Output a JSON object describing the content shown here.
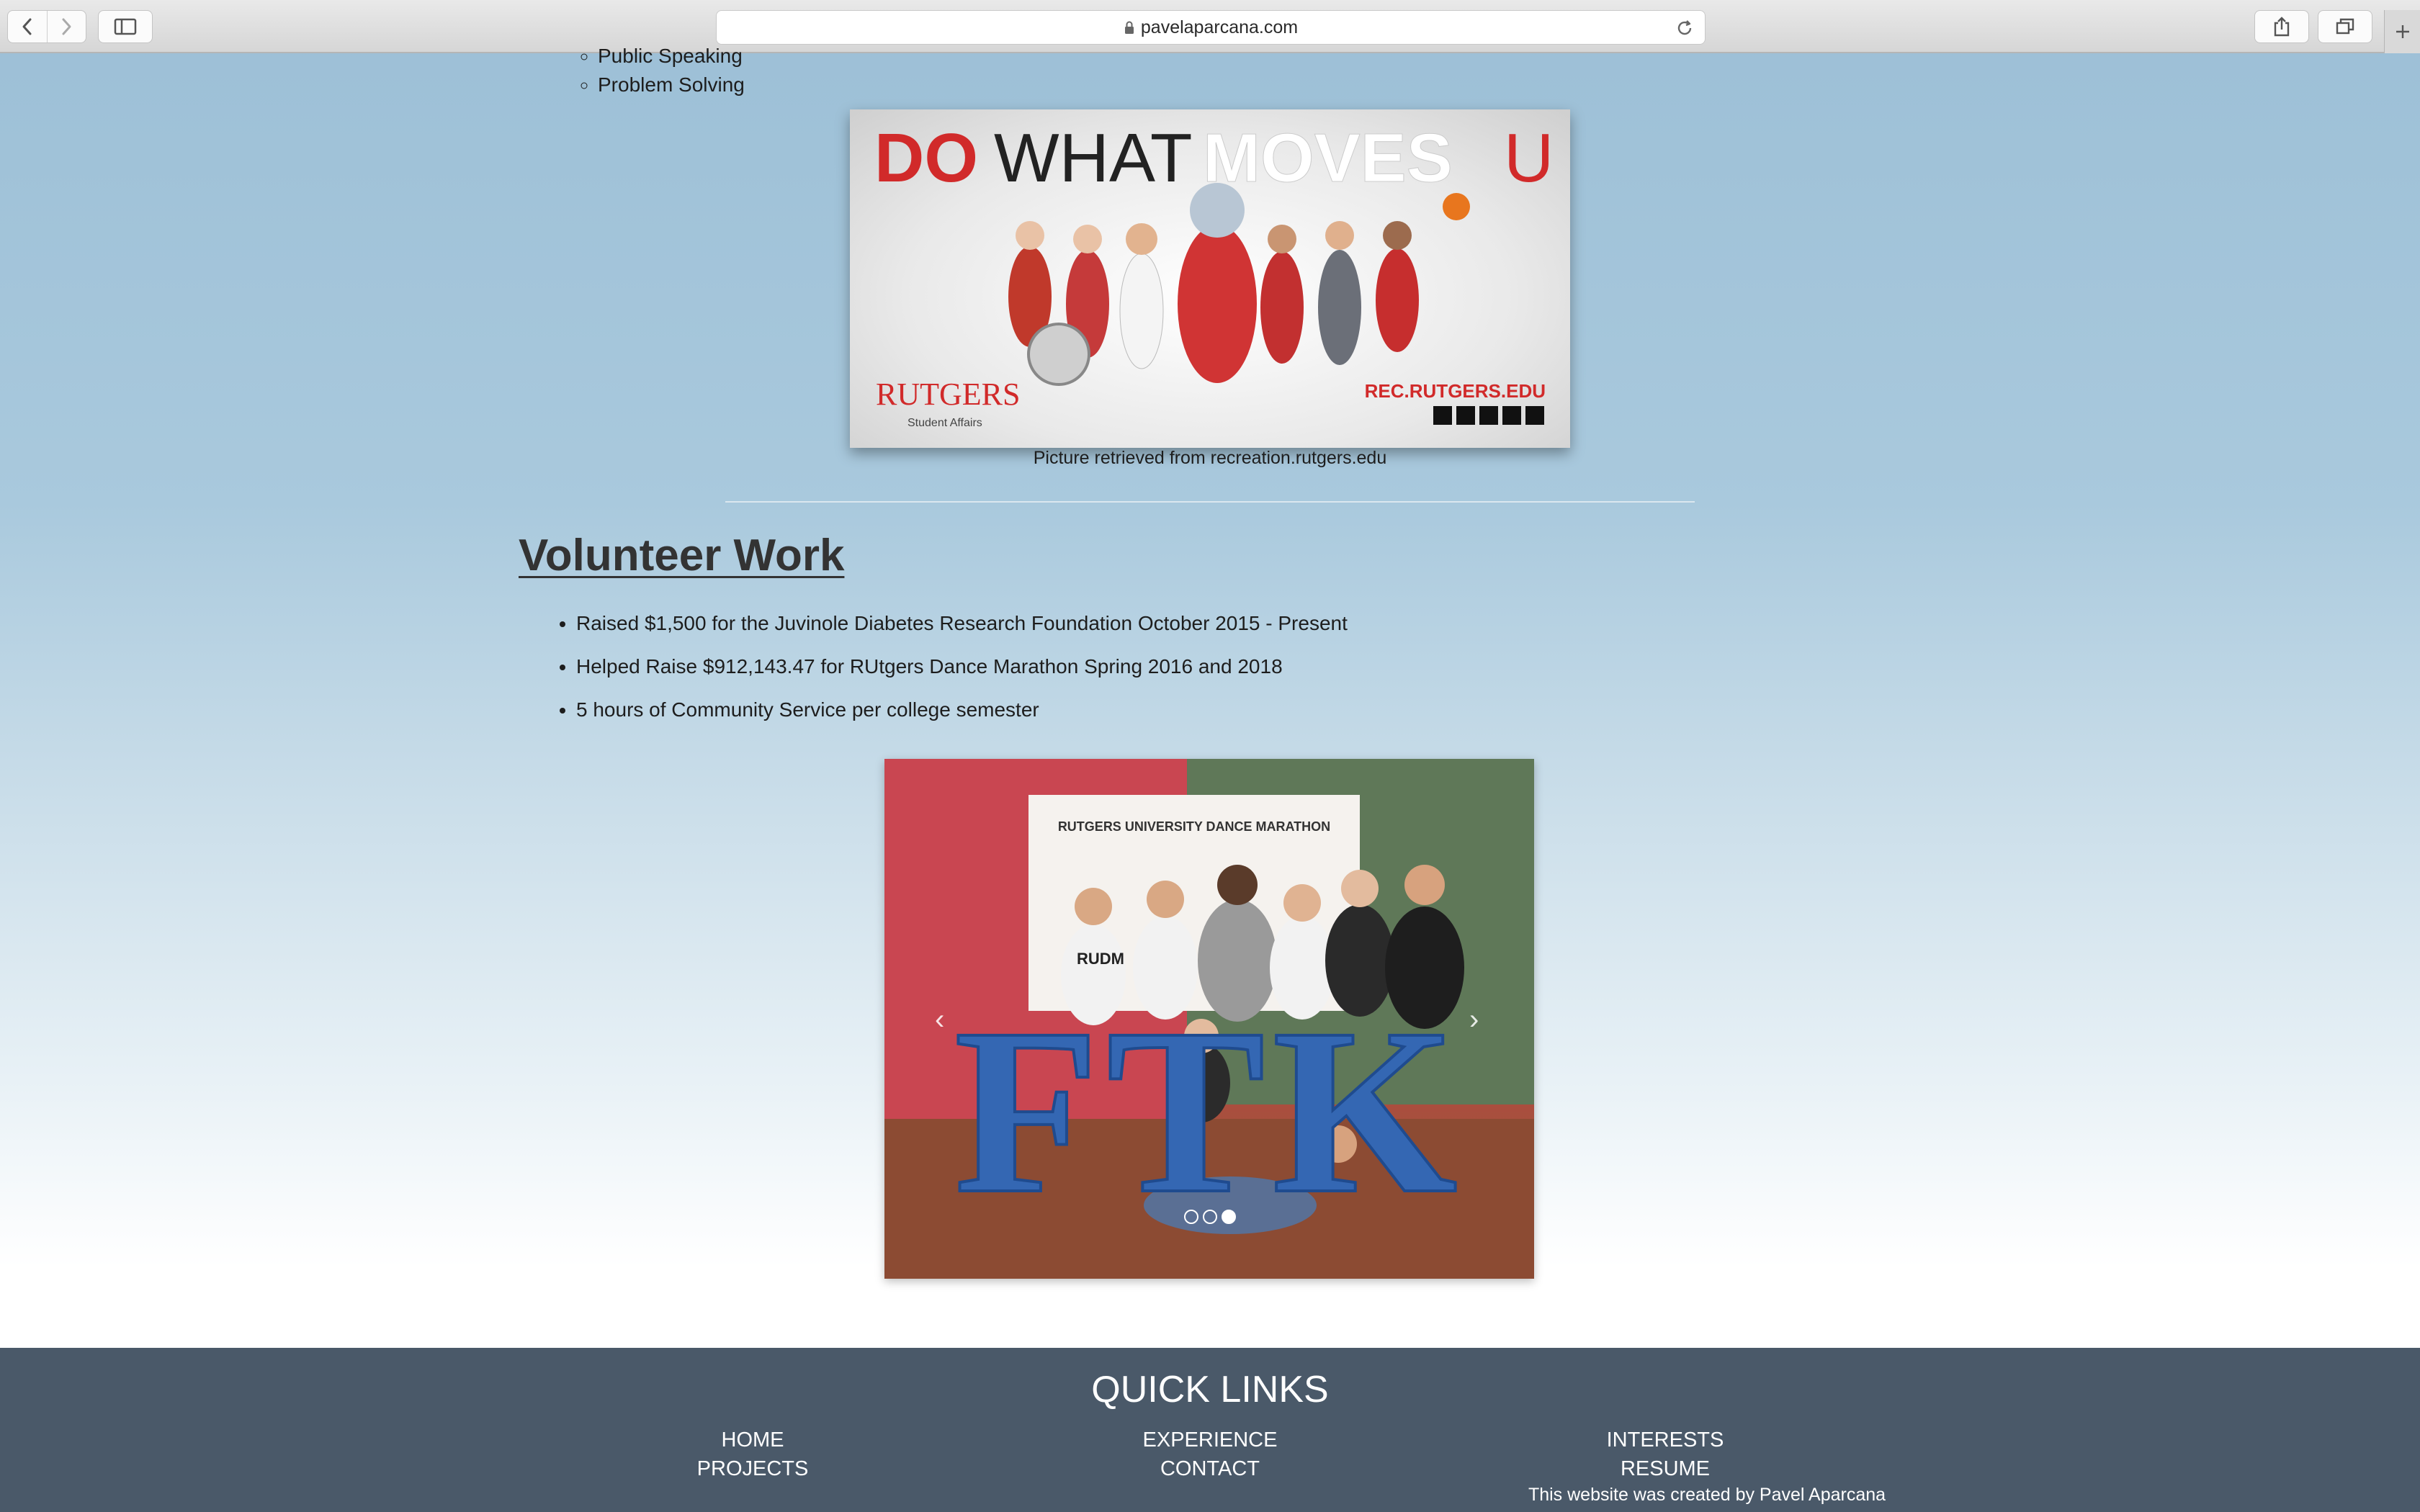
{
  "browser": {
    "url": "pavelaparcana.com",
    "icons": {
      "back": "chevron-left-icon",
      "forward": "chevron-right-icon",
      "sidebar": "sidebar-icon",
      "lock": "lock-icon",
      "reload": "reload-icon",
      "share": "share-icon",
      "tabs": "tabs-icon",
      "new_tab": "plus-icon"
    }
  },
  "skills": {
    "items": [
      "Public Speaking",
      "Problem Solving"
    ]
  },
  "rec_image": {
    "headline_do": "DO",
    "headline_what": "WHAT",
    "headline_moves": "MOVES",
    "headline_u": "U",
    "brand": "RUTGERS",
    "brand_sub": "Student Affairs",
    "site": "REC.RUTGERS.EDU",
    "caption": "Picture retrieved from recreation.rutgers.edu"
  },
  "volunteer": {
    "title": "Volunteer Work",
    "items": [
      "Raised $1,500 for the Juvinole Diabetes Research Foundation October 2015 - Present",
      "Helped Raise $912,143.47 for RUtgers Dance Marathon Spring 2016 and 2018",
      "5 hours of Community Service per college semester"
    ]
  },
  "carousel": {
    "banner_text": "RUTGERS UNIVERSITY DANCE MARATHON",
    "letters": "FTK",
    "shirt_text": "RUDM",
    "prev_arrow": "‹",
    "next_arrow": "›",
    "slide_count": 3,
    "active_slide": 3
  },
  "footer": {
    "title": "QUICK LINKS",
    "links": {
      "home": "HOME",
      "projects": "PROJECTS",
      "experience": "EXPERIENCE",
      "contact": "CONTACT",
      "interests": "INTERESTS",
      "resume": "RESUME"
    },
    "credit": "This website was created by Pavel Aparcana"
  },
  "colors": {
    "page_top": "#9cbfd6",
    "footer_bg": "#4a5969",
    "rutgers_red": "#d12a2a"
  }
}
